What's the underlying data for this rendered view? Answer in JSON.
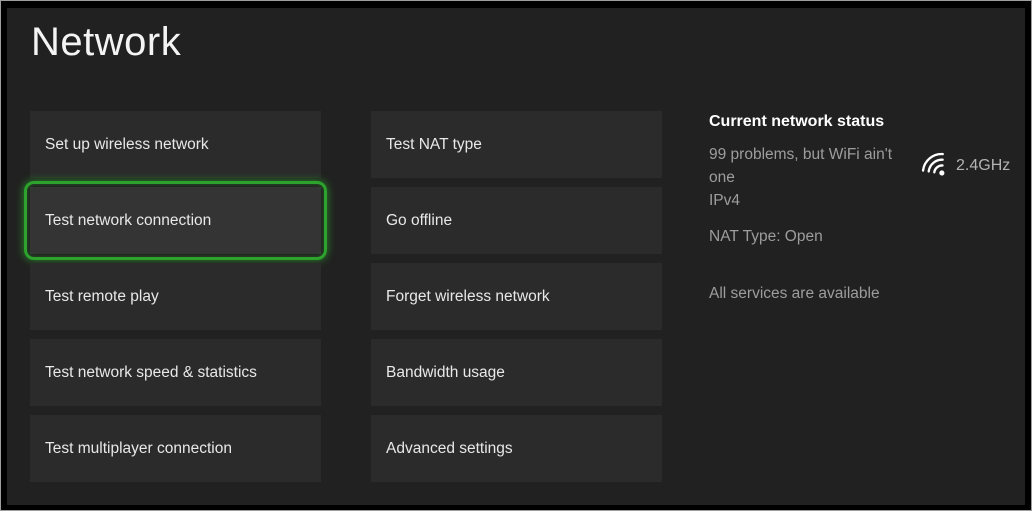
{
  "window": {
    "title": "Network"
  },
  "colors": {
    "frame": "#000000",
    "background": "#212121",
    "tile": "#2b2b2b",
    "tile_selected": "#343434",
    "focus_green": "#2da32d",
    "text_primary": "#e8e8e8",
    "text_secondary": "#9d9d9d"
  },
  "menu": {
    "columns": [
      {
        "items": [
          {
            "label": "Set up wireless network",
            "selected": false
          },
          {
            "label": "Test network connection",
            "selected": true
          },
          {
            "label": "Test remote play",
            "selected": false
          },
          {
            "label": "Test network speed & statistics",
            "selected": false
          },
          {
            "label": "Test multiplayer connection",
            "selected": false
          }
        ]
      },
      {
        "items": [
          {
            "label": "Test NAT type",
            "selected": false
          },
          {
            "label": "Go offline",
            "selected": false
          },
          {
            "label": "Forget wireless network",
            "selected": false
          },
          {
            "label": "Bandwidth usage",
            "selected": false
          },
          {
            "label": "Advanced settings",
            "selected": false
          }
        ]
      }
    ]
  },
  "status": {
    "heading": "Current network status",
    "network_name": "99 problems, but WiFi ain't one",
    "band": "2.4GHz",
    "band_icon": "wifi-icon",
    "ip_version": "IPv4",
    "nat_type": "NAT Type: Open",
    "services_status": "All services are available"
  }
}
